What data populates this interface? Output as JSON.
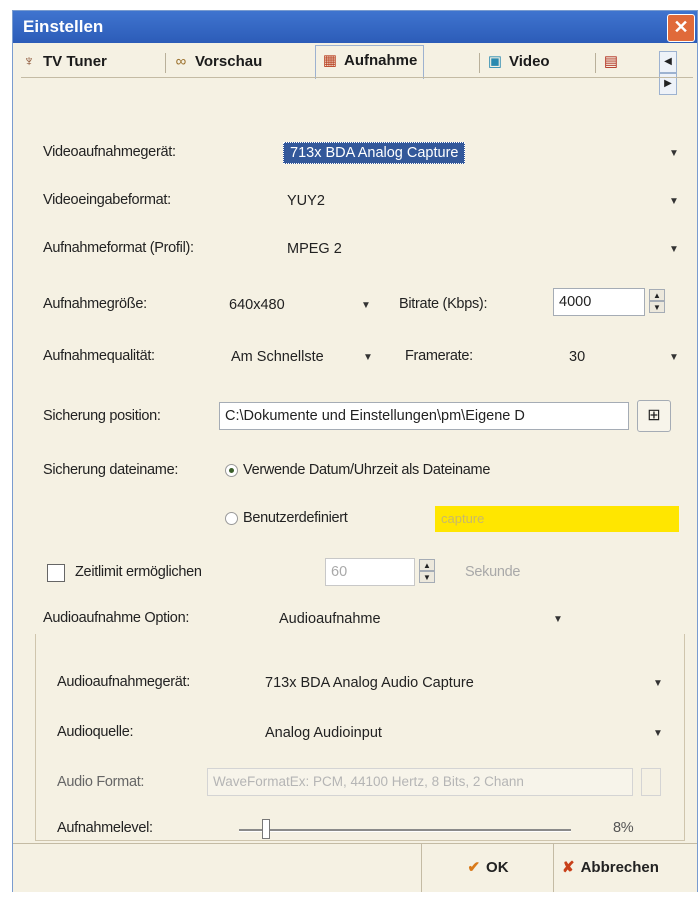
{
  "window": {
    "title": "Einstellen"
  },
  "tabs": [
    {
      "label": "TV Tuner",
      "icon": "tv-antenna-icon"
    },
    {
      "label": "Vorschau",
      "icon": "glasses-icon"
    },
    {
      "label": "Aufnahme",
      "icon": "film-icon"
    },
    {
      "label": "Video",
      "icon": "monitor-icon"
    },
    {
      "label": "",
      "icon": "projector-icon"
    }
  ],
  "form": {
    "video_device": {
      "label": "Videoaufnahmegerät:",
      "value": "713x BDA Analog Capture"
    },
    "video_input_format": {
      "label": "Videoeingabeformat:",
      "value": "YUY2"
    },
    "record_format": {
      "label": "Aufnahmeformat (Profil):",
      "value": "MPEG 2"
    },
    "record_size": {
      "label": "Aufnahmegröße:",
      "value": "640x480"
    },
    "bitrate": {
      "label": "Bitrate (Kbps):",
      "value": "4000"
    },
    "record_quality": {
      "label": "Aufnahmequalität:",
      "value": "Am Schnellste"
    },
    "framerate": {
      "label": "Framerate:",
      "value": "30"
    },
    "save_position": {
      "label": "Sicherung position:",
      "value": "C:\\Dokumente und Einstellungen\\pm\\Eigene D"
    },
    "save_filename": {
      "label": "Sicherung dateiname:",
      "option_datetime": "Verwende Datum/Uhrzeit als Dateiname",
      "option_custom": "Benutzerdefiniert",
      "custom_value": "capture"
    },
    "time_limit": {
      "label": "Zeitlimit ermöglichen",
      "value": "60",
      "unit": "Sekunde"
    },
    "audio_option": {
      "label": "Audioaufnahme Option:",
      "value": "Audioaufnahme"
    },
    "audio_device": {
      "label": "Audioaufnahmegerät:",
      "value": "713x BDA Analog Audio Capture"
    },
    "audio_source": {
      "label": "Audioquelle:",
      "value": "Analog Audioinput"
    },
    "audio_format": {
      "label": "Audio Format:",
      "value": "WaveFormatEx: PCM, 44100 Hertz, 8 Bits, 2 Chann"
    },
    "record_level": {
      "label": "Aufnahmelevel:",
      "value_text": "8%",
      "value": 0.08
    }
  },
  "footer": {
    "ok": "OK",
    "cancel": "Abbrechen"
  },
  "colors": {
    "title_bar": "#2c5cb8",
    "close": "#e06a3a",
    "selection": "#33589a",
    "custom_field": "#ffe600",
    "panel_bg": "#f5f1e3"
  }
}
